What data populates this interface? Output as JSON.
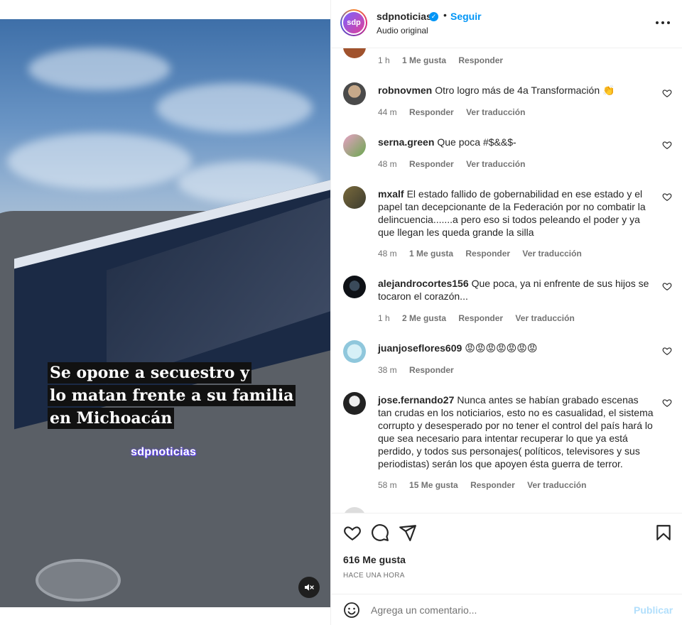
{
  "video": {
    "caption_lines": [
      "Se opone a secuestro y",
      "lo matan frente a su familia",
      "en Michoacán"
    ],
    "watermark": "sdpnoticias",
    "mute_icon": "speaker-muted-icon"
  },
  "header": {
    "avatar_text": "sdp",
    "username": "sdpnoticias",
    "verified_icon": "verified-badge-icon",
    "dot": "•",
    "follow_label": "Seguir",
    "subtitle": "Audio original",
    "more_icon": "more-options-icon"
  },
  "comments": [
    {
      "user": "",
      "text": "",
      "time": "1 h",
      "likes": "1 Me gusta",
      "reply": "Responder",
      "translate": ""
    },
    {
      "user": "robnovmen",
      "text": "Otro logro más de 4a Transformación 👏",
      "time": "44 m",
      "likes": "",
      "reply": "Responder",
      "translate": "Ver traducción"
    },
    {
      "user": "serna.green",
      "text": "Que poca #$&&$-",
      "time": "48 m",
      "likes": "",
      "reply": "Responder",
      "translate": "Ver traducción"
    },
    {
      "user": "mxalf",
      "text": "El estado fallido de gobernabilidad en ese estado y el papel tan decepcionante de la Federación por no combatir la delincuencia.......a pero eso si todos peleando el poder y ya que llegan les queda grande la silla",
      "time": "48 m",
      "likes": "1 Me gusta",
      "reply": "Responder",
      "translate": "Ver traducción"
    },
    {
      "user": "alejandrocortes156",
      "text": "Que poca, ya ni enfrente de sus hijos se tocaron el corazón...",
      "time": "1 h",
      "likes": "2 Me gusta",
      "reply": "Responder",
      "translate": "Ver traducción"
    },
    {
      "user": "juanjoseflores609",
      "text": "😡😡😡😡😡😡😡",
      "time": "38 m",
      "likes": "",
      "reply": "Responder",
      "translate": ""
    },
    {
      "user": "jose.fernando27",
      "text": "Nunca antes se habían grabado escenas tan crudas en los noticiarios, esto no es casualidad, el sistema corrupto y desesperado por no tener el control del país hará lo que sea necesario para intentar recuperar lo que ya está perdido, y todos sus personajes( políticos, televisores y sus periodistas) serán los que apoyen ésta guerra de terror.",
      "time": "58 m",
      "likes": "15 Me gusta",
      "reply": "Responder",
      "translate": "Ver traducción"
    }
  ],
  "actions": {
    "like_icon": "heart-icon",
    "comment_icon": "comment-icon",
    "share_icon": "share-icon",
    "save_icon": "bookmark-icon",
    "likes": "616 Me gusta",
    "time": "HACE UNA HORA"
  },
  "composer": {
    "emoji_icon": "emoji-icon",
    "placeholder": "Agrega un comentario...",
    "publish_label": "Publicar"
  }
}
